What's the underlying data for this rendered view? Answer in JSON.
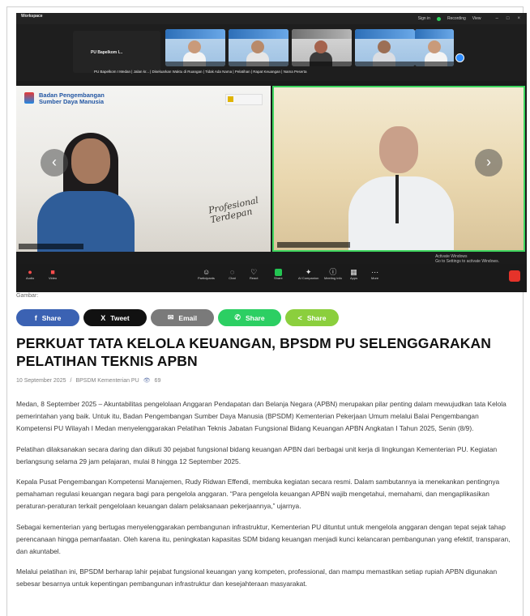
{
  "screenshot": {
    "app_title": "Workspace",
    "top_controls": [
      "Sign in",
      "Recording",
      "View"
    ],
    "featured_speaker": "PU Bapelkom I...",
    "participants_strip": "PU Bapelkom I Medan | Jalan kr... | Diseluarkan Waktu di Ruangan | Tidak Ada Nama | Pelatihan | Rapat Keuangan | Nama Peserta",
    "left_pane_logo": [
      "Badan Pengembangan",
      "Sumber Daya Manusia"
    ],
    "signature": [
      "Profesional",
      "Terdepan"
    ],
    "activate_windows": [
      "Activate Windows",
      "Go to Settings to activate Windows."
    ],
    "toolbar": [
      "Audio",
      "Video",
      "Participants",
      "Chat",
      "React",
      "Share",
      "AI Companion",
      "Meeting info",
      "Apps",
      "More",
      "Leave"
    ],
    "nav_prev": "‹",
    "nav_next": "›"
  },
  "caption": "Gambar:",
  "share_buttons": [
    {
      "label": "Share",
      "icon": "f",
      "color": "#3b62b3",
      "width": 78
    },
    {
      "label": "Tweet",
      "icon": "X",
      "color": "#111111",
      "width": 78
    },
    {
      "label": "Email",
      "icon": "✉",
      "color": "#7a7a7a",
      "width": 78
    },
    {
      "label": "Share",
      "icon": "✆",
      "color": "#2ccf63",
      "width": 78
    },
    {
      "label": "Share",
      "icon": "<",
      "color": "#8bcf3d",
      "width": 66
    }
  ],
  "article": {
    "title": "PERKUAT TATA KELOLA KEUANGAN, BPSDM PU SELENGGARAKAN PELATIHAN TEKNIS APBN",
    "date": "10 September 2025",
    "separator": "/",
    "author": "BPSDM Kementerian PU",
    "views": "69",
    "paragraphs": [
      "Medan, 8 September 2025 – Akuntabilitas pengelolaan Anggaran Pendapatan dan Belanja Negara (APBN) merupakan pilar penting dalam mewujudkan tata Kelola pemerintahan yang baik. Untuk itu, Badan Pengembangan Sumber Daya Manusia (BPSDM) Kementerian Pekerjaan Umum melalui Balai Pengembangan Kompetensi PU Wilayah I Medan menyelenggarakan Pelatihan Teknis Jabatan Fungsional Bidang Keuangan APBN Angkatan I Tahun 2025, Senin (8/9).",
      "Pelatihan dilaksanakan secara daring dan diikuti 30 pejabat fungsional bidang keuangan APBN dari berbagai unit kerja di lingkungan Kementerian PU. Kegiatan berlangsung selama 29 jam pelajaran, mulai 8 hingga 12 September 2025.",
      "Kepala Pusat Pengembangan Kompetensi Manajemen, Rudy Ridwan Effendi, membuka kegiatan secara resmi. Dalam sambutannya ia menekankan pentingnya pemahaman regulasi keuangan negara bagi para pengelola anggaran. “Para pengelola keuangan APBN wajib mengetahui, memahami, dan mengaplikasikan peraturan-peraturan terkait pengelolaan keuangan dalam pelaksanaan pekerjaannya,” ujarnya.",
      "Sebagai kementerian yang bertugas menyelenggarakan pembangunan infrastruktur, Kementerian PU dituntut untuk mengelola anggaran dengan tepat sejak tahap perencanaan hingga pemanfaatan. Oleh karena itu, peningkatan kapasitas SDM bidang keuangan menjadi kunci kelancaran pembangunan yang efektif, transparan, dan akuntabel.",
      "Melalui pelatihan ini, BPSDM berharap lahir pejabat fungsional keuangan yang kompeten, professional, dan mampu memastikan setiap rupiah APBN digunakan sebesar besarnya untuk kepentingan pembangunan infrastruktur dan kesejahteraan masyarakat."
    ]
  }
}
